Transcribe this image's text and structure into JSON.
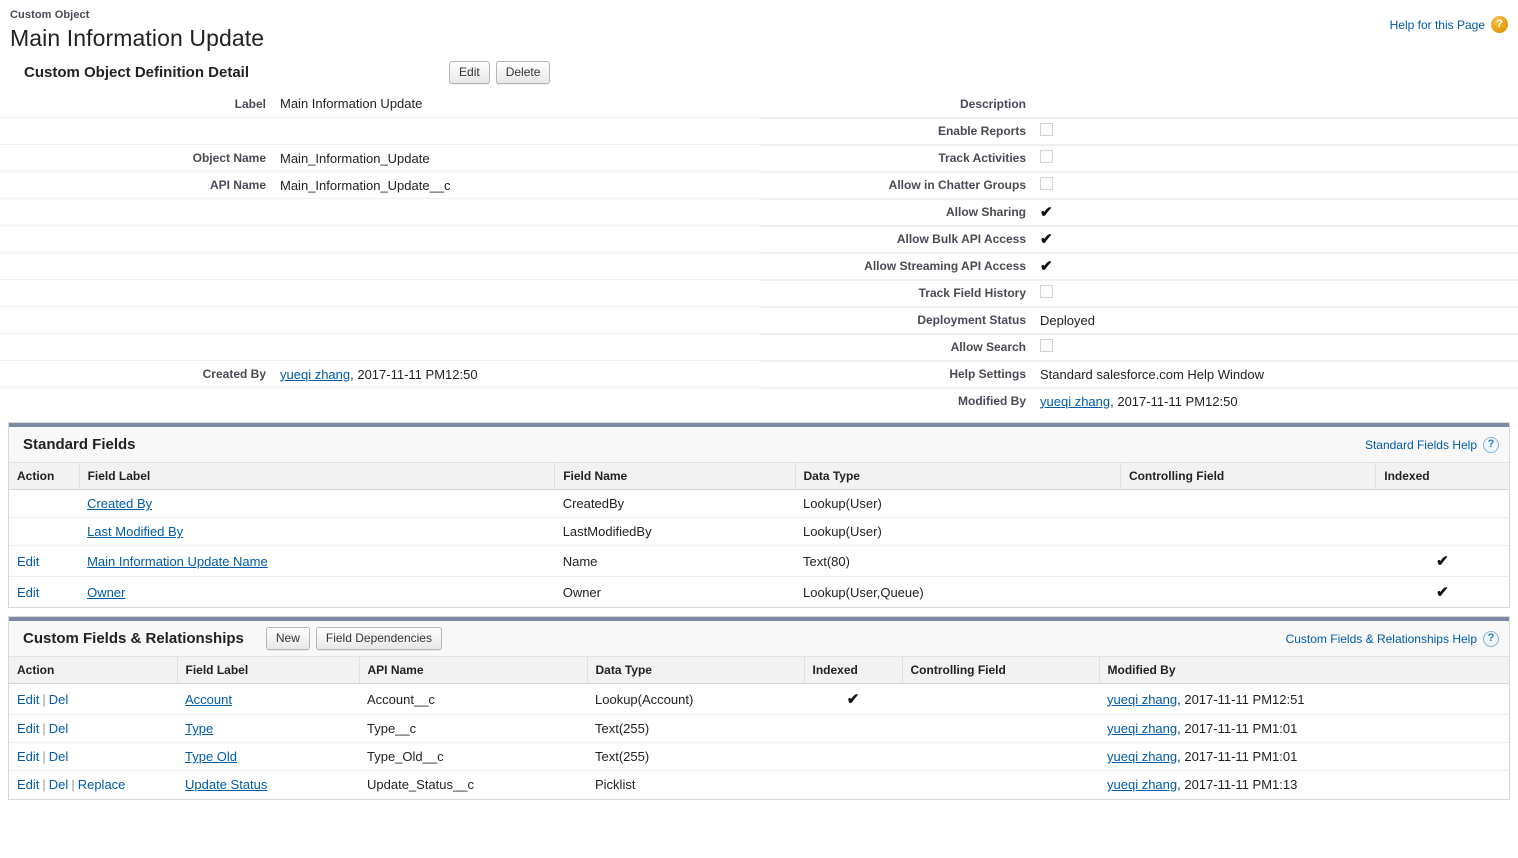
{
  "header": {
    "object_type": "Custom Object",
    "title": "Main Information Update",
    "help_link": "Help for this Page",
    "help_icon": "question-mark-orange-icon"
  },
  "detail": {
    "section_title": "Custom Object Definition Detail",
    "buttons": {
      "edit": "Edit",
      "delete": "Delete"
    },
    "left": [
      {
        "label": "Label",
        "value": "Main Information Update",
        "type": "text"
      },
      {
        "label": "",
        "value": "",
        "type": "blank"
      },
      {
        "label": "Object Name",
        "value": "Main_Information_Update",
        "type": "text"
      },
      {
        "label": "API Name",
        "value": "Main_Information_Update__c",
        "type": "text"
      },
      {
        "label": "",
        "value": "",
        "type": "blank"
      },
      {
        "label": "",
        "value": "",
        "type": "blank"
      },
      {
        "label": "",
        "value": "",
        "type": "blank"
      },
      {
        "label": "",
        "value": "",
        "type": "blank"
      },
      {
        "label": "",
        "value": "",
        "type": "blank"
      },
      {
        "label": "",
        "value": "",
        "type": "blank"
      },
      {
        "label": "Created By",
        "value": "yueqi zhang",
        "suffix": ", 2017-11-11 PM12:50",
        "type": "link"
      }
    ],
    "right": [
      {
        "label": "Description",
        "value": "",
        "type": "text"
      },
      {
        "label": "Enable Reports",
        "value": "unchecked",
        "type": "check"
      },
      {
        "label": "Track Activities",
        "value": "unchecked",
        "type": "check"
      },
      {
        "label": "Allow in Chatter Groups",
        "value": "unchecked",
        "type": "check"
      },
      {
        "label": "Allow Sharing",
        "value": "checked",
        "type": "check"
      },
      {
        "label": "Allow Bulk API Access",
        "value": "checked",
        "type": "check"
      },
      {
        "label": "Allow Streaming API Access",
        "value": "checked",
        "type": "check"
      },
      {
        "label": "Track Field History",
        "value": "unchecked",
        "type": "check"
      },
      {
        "label": "Deployment Status",
        "value": "Deployed",
        "type": "text"
      },
      {
        "label": "Allow Search",
        "value": "unchecked",
        "type": "check"
      },
      {
        "label": "Help Settings",
        "value": "Standard salesforce.com Help Window",
        "type": "text"
      },
      {
        "label": "Modified By",
        "value": "yueqi zhang",
        "suffix": ", 2017-11-11 PM12:50",
        "type": "link"
      }
    ]
  },
  "standard_fields": {
    "title": "Standard Fields",
    "help_link": "Standard Fields Help",
    "help_icon": "question-mark-blue-icon",
    "columns": [
      "Action",
      "Field Label",
      "Field Name",
      "Data Type",
      "Controlling Field",
      "Indexed"
    ],
    "rows": [
      {
        "action": "",
        "field_label": "Created By",
        "field_name": "CreatedBy",
        "data_type": "Lookup(User)",
        "controlling_field": "",
        "indexed": ""
      },
      {
        "action": "",
        "field_label": "Last Modified By",
        "field_name": "LastModifiedBy",
        "data_type": "Lookup(User)",
        "controlling_field": "",
        "indexed": ""
      },
      {
        "action": "Edit",
        "field_label": "Main Information Update Name",
        "field_name": "Name",
        "data_type": "Text(80)",
        "controlling_field": "",
        "indexed": "checked"
      },
      {
        "action": "Edit",
        "field_label": "Owner",
        "field_name": "Owner",
        "data_type": "Lookup(User,Queue)",
        "controlling_field": "",
        "indexed": "checked"
      }
    ]
  },
  "custom_fields": {
    "title": "Custom Fields & Relationships",
    "help_link": "Custom Fields & Relationships Help",
    "help_icon": "question-mark-blue-icon",
    "buttons": {
      "new": "New",
      "field_dependencies": "Field Dependencies"
    },
    "columns": [
      "Action",
      "Field Label",
      "API Name",
      "Data Type",
      "Indexed",
      "Controlling Field",
      "Modified By"
    ],
    "rows": [
      {
        "actions": [
          "Edit",
          "Del"
        ],
        "field_label": "Account",
        "api_name": "Account__c",
        "data_type": "Lookup(Account)",
        "indexed": "checked",
        "controlling_field": "",
        "modified_by_user": "yueqi zhang",
        "modified_by_date": ", 2017-11-11 PM12:51"
      },
      {
        "actions": [
          "Edit",
          "Del"
        ],
        "field_label": "Type",
        "api_name": "Type__c",
        "data_type": "Text(255)",
        "indexed": "",
        "controlling_field": "",
        "modified_by_user": "yueqi zhang",
        "modified_by_date": ", 2017-11-11 PM1:01"
      },
      {
        "actions": [
          "Edit",
          "Del"
        ],
        "field_label": "Type Old",
        "api_name": "Type_Old__c",
        "data_type": "Text(255)",
        "indexed": "",
        "controlling_field": "",
        "modified_by_user": "yueqi zhang",
        "modified_by_date": ", 2017-11-11 PM1:01"
      },
      {
        "actions": [
          "Edit",
          "Del",
          "Replace"
        ],
        "field_label": "Update Status",
        "api_name": "Update_Status__c",
        "data_type": "Picklist",
        "indexed": "",
        "controlling_field": "",
        "modified_by_user": "yueqi zhang",
        "modified_by_date": ", 2017-11-11 PM1:13"
      }
    ]
  },
  "colors": {
    "link": "#015ba7",
    "panel_bar": "#7e8aa2",
    "help_orb": "#e8a317"
  }
}
